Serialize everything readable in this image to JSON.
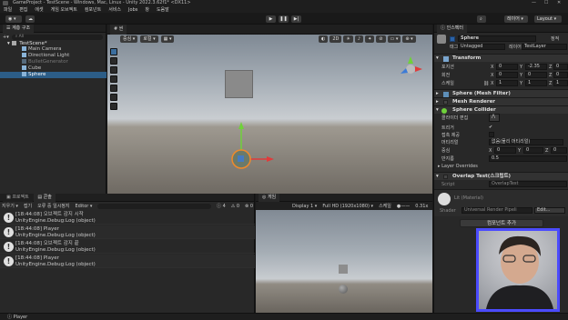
{
  "title_bar": {
    "title": "GameProject - TestScene - Windows, Mac, Linux - Unity 2022.3.62f1* <DX11>"
  },
  "menu": [
    "파일",
    "편집",
    "에셋",
    "게임 오브젝트",
    "컴포넌트",
    "서비스",
    "Jobs",
    "창",
    "도움말"
  ],
  "toolbar": {
    "account_label": "",
    "layers_label": "레이어",
    "layout_label": "Layout"
  },
  "hierarchy": {
    "tab_label": "계층 구조",
    "search_placeholder": "All",
    "scene_name": "TestScene*",
    "items": [
      "Main Camera",
      "Directional Light",
      "BulletGenerator",
      "Cube",
      "Sphere"
    ]
  },
  "scene": {
    "tab_label": "씬",
    "view_mode": "중심",
    "space_mode": "로컬",
    "view_2d": "2D"
  },
  "inspector": {
    "tab_label": "인스펙터",
    "object_name": "Sphere",
    "static_label": "정적",
    "tag_label": "태그",
    "tag_value": "Untagged",
    "layer_label": "레이어",
    "layer_value": "TestLayer",
    "transform": {
      "title": "Transform",
      "position_label": "포지션",
      "rotation_label": "회전",
      "scale_label": "스케일",
      "position": {
        "x": "0",
        "y": "-2.35",
        "z": "0"
      },
      "rotation": {
        "x": "0",
        "y": "0",
        "z": "0"
      },
      "scale": {
        "x": "1",
        "y": "1",
        "z": "1"
      }
    },
    "mesh_filter": {
      "title": "Sphere (Mesh Filter)"
    },
    "mesh_renderer": {
      "title": "Mesh Renderer"
    },
    "sphere_collider": {
      "title": "Sphere Collider",
      "edit_label": "콜라이더 편집",
      "trigger_label": "트리거",
      "contact_label": "접촉 제공",
      "material_label": "머티리얼",
      "material_value": "없음(물리 머티리얼)",
      "center_label": "중심",
      "center": {
        "x": "0",
        "y": "0",
        "z": "0"
      },
      "radius_label": "반지름",
      "radius_value": "0.5"
    },
    "layer_overrides_label": "Layer Overrides",
    "script_component": {
      "title": "Overlap Test(스크립트)",
      "script_label": "Script",
      "script_value": "OverlapTest"
    },
    "material": {
      "name": "Lit (Material)",
      "shader_label": "Shader",
      "shader_value": "Universal Render Pipeli",
      "edit_label": "Edit..."
    },
    "add_component_label": "컴포넌트 추가"
  },
  "console": {
    "tab_project": "프로젝트",
    "tab_console": "콘솔",
    "clear_label": "지우기",
    "collapse_label": "접기",
    "error_pause_label": "오류 중 일시정지",
    "editor_label": "Editor",
    "log_count": "4",
    "warn_count": "0",
    "error_count": "0",
    "logs": [
      {
        "line1": "[18:44:08] 오브젝트 감지 시작",
        "line2": "UnityEngine.Debug:Log (object)"
      },
      {
        "line1": "[18:44:08] Player",
        "line2": "UnityEngine.Debug:Log (object)"
      },
      {
        "line1": "[18:44:08] 오브젝트 감지 끝",
        "line2": "UnityEngine.Debug:Log (object)"
      },
      {
        "line1": "[18:44:08] Player",
        "line2": "UnityEngine.Debug:Log (object)"
      }
    ]
  },
  "game": {
    "tab_label": "게임",
    "display": "Display 1",
    "resolution": "Full HD (1920x1080)",
    "scale_label": "스케일",
    "scale_value": "0.31x"
  },
  "status": {
    "text": "Player"
  }
}
